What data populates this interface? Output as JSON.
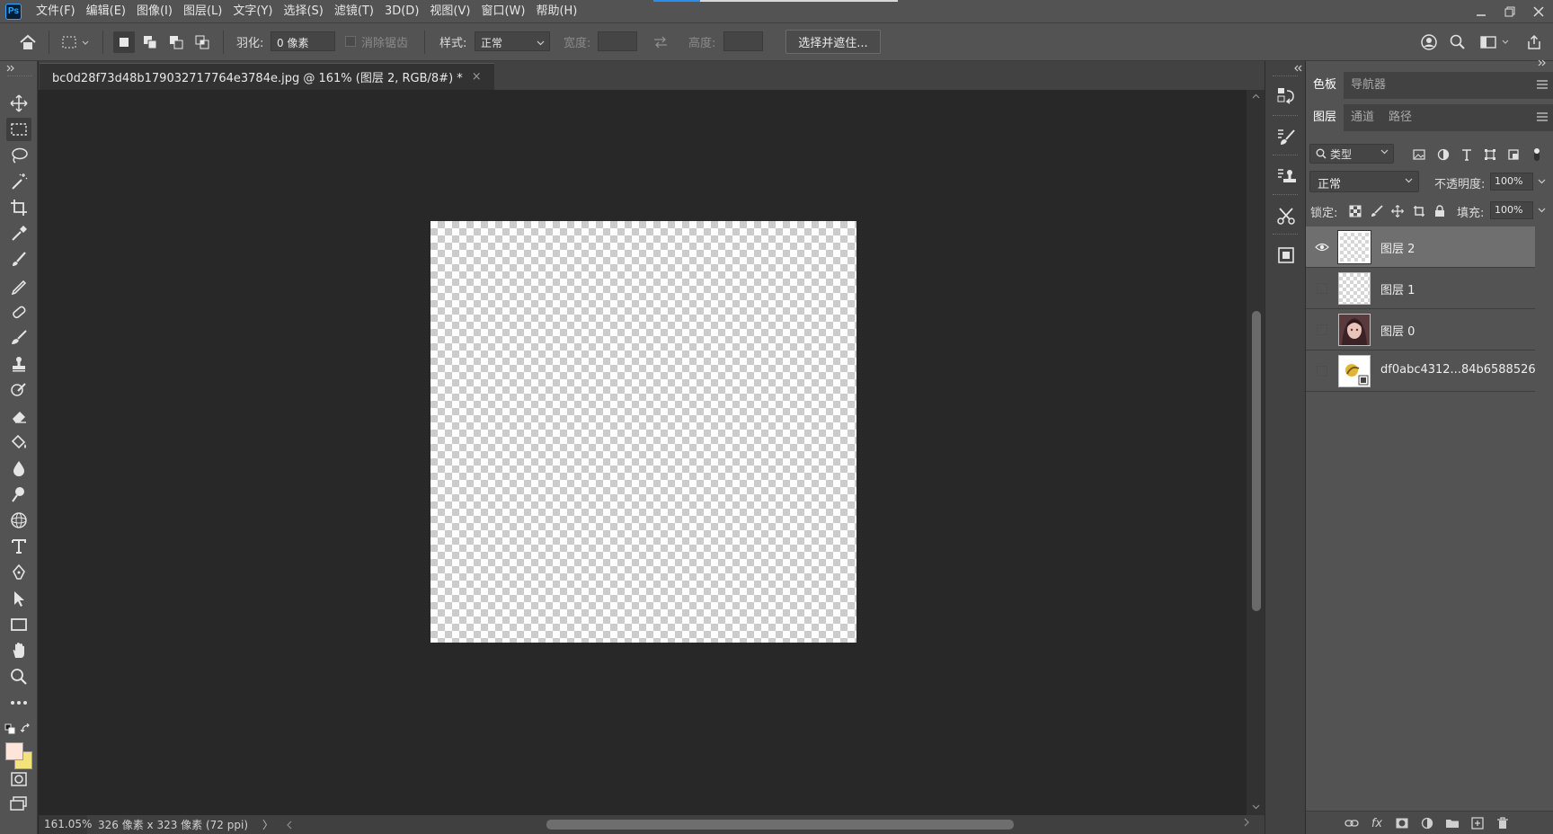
{
  "app": {
    "logo": "Ps"
  },
  "menu": [
    "文件(F)",
    "编辑(E)",
    "图像(I)",
    "图层(L)",
    "文字(Y)",
    "选择(S)",
    "滤镜(T)",
    "3D(D)",
    "视图(V)",
    "窗口(W)",
    "帮助(H)"
  ],
  "options": {
    "feather_label": "羽化:",
    "feather_value": "0 像素",
    "antialias_label": "消除锯齿",
    "style_label": "样式:",
    "style_value": "正常",
    "width_label": "宽度:",
    "height_label": "高度:",
    "select_mask_label": "选择并遮住..."
  },
  "document": {
    "tab_title": "bc0d28f73d48b179032717764e3784e.jpg @ 161% (图层 2, RGB/8#) *",
    "close_glyph": "×"
  },
  "status": {
    "zoom": "161.05%",
    "dimensions": "326 像素 x 323 像素 (72 ppi)",
    "arrow": "〉"
  },
  "panels": {
    "top_tabs": [
      "色板",
      "导航器"
    ],
    "layer_tabs": [
      "图层",
      "通道",
      "路径"
    ],
    "filter_label": "类型",
    "blend_mode": "正常",
    "opacity_label": "不透明度:",
    "opacity_value": "100%",
    "lock_label": "锁定:",
    "fill_label": "填充:",
    "fill_value": "100%"
  },
  "layers": [
    {
      "name": "图层 2",
      "visible": true,
      "selected": true,
      "thumb": "transparent"
    },
    {
      "name": "图层 1",
      "visible": false,
      "selected": false,
      "thumb": "transparent"
    },
    {
      "name": "图层 0",
      "visible": false,
      "selected": false,
      "thumb": "portrait"
    },
    {
      "name": "df0abc4312...84b6588526",
      "visible": false,
      "selected": false,
      "thumb": "smart-object"
    }
  ],
  "colors": {
    "foreground": "#ffe5d9",
    "background": "#f4e27a",
    "accent": "#31a8ff"
  },
  "footer_icons": [
    "link-icon",
    "fx-icon",
    "mask-icon",
    "adjustment-icon",
    "group-icon",
    "new-layer-icon",
    "trash-icon"
  ],
  "footer": {
    "fx_label": "fx"
  }
}
